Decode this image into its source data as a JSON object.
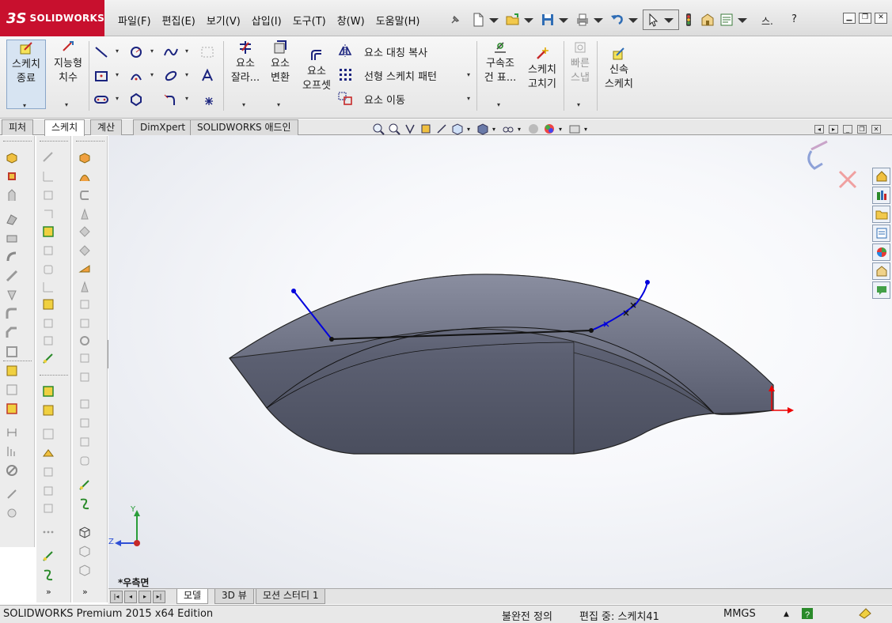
{
  "app": {
    "logo_brand": "3S",
    "logo_name": "SOLIDWORKS"
  },
  "menu": [
    {
      "label": "파일(F)"
    },
    {
      "label": "편집(E)"
    },
    {
      "label": "보기(V)"
    },
    {
      "label": "삽입(I)"
    },
    {
      "label": "도구(T)"
    },
    {
      "label": "창(W)"
    },
    {
      "label": "도움말(H)"
    }
  ],
  "quick_access": {
    "extra_label": "스.",
    "help_label": "?"
  },
  "command_manager": {
    "exit_sketch": "스케치\n종료",
    "smart_dim": "지능형\n치수",
    "trim": "요소\n잘라...",
    "convert": "요소\n변환",
    "offset": "요소\n오프셋",
    "mirror": "요소 대칭 복사",
    "linear_pattern": "선형 스케치 패턴",
    "move": "요소 이동",
    "relations": "구속조\n건 표...",
    "repair": "스케치\n고치기",
    "quick_snaps": "빠른\n스냅",
    "rapid_sketch": "신속\n스케치"
  },
  "tabs": [
    {
      "label": "피처"
    },
    {
      "label": "스케치"
    },
    {
      "label": "계산"
    },
    {
      "label": "DimXpert"
    },
    {
      "label": "SOLIDWORKS 애드인"
    }
  ],
  "viewport": {
    "view_name": "*우측면",
    "triad": {
      "y": "Y",
      "z": "Z"
    },
    "model_color": "#5c6072",
    "sketch_color": "#0000dd"
  },
  "bottom_tabs": [
    {
      "label": "모델"
    },
    {
      "label": "3D 뷰"
    },
    {
      "label": "모션 스터디 1"
    }
  ],
  "status": {
    "edition": "SOLIDWORKS Premium 2015 x64 Edition",
    "definition": "불완전 정의",
    "editing": "편집 중: 스케치41",
    "units": "MMGS",
    "units_arrow": "▲"
  },
  "icons": [
    "pin-icon",
    "new-icon",
    "open-icon",
    "save-icon",
    "print-icon",
    "undo-icon",
    "select-icon",
    "traffic-light-icon",
    "options-icon",
    "file-properties-icon",
    "line-icon",
    "circle-icon",
    "spline-icon",
    "rectangle-icon",
    "arc-icon",
    "ellipse-icon",
    "text-icon",
    "slot-icon",
    "polygon-icon",
    "fillet-icon",
    "point-icon",
    "mirror-icon",
    "pattern-icon",
    "move-icon",
    "zoom-fit-icon",
    "zoom-area-icon",
    "previous-view-icon",
    "section-view-icon",
    "view-orientation-icon",
    "display-style-icon",
    "hide-show-icon",
    "appearance-icon",
    "scene-icon",
    "view-settings-icon",
    "home-icon",
    "library-icon",
    "folder-icon",
    "explorer-icon",
    "color-icon",
    "custom-properties-icon",
    "forum-icon"
  ]
}
